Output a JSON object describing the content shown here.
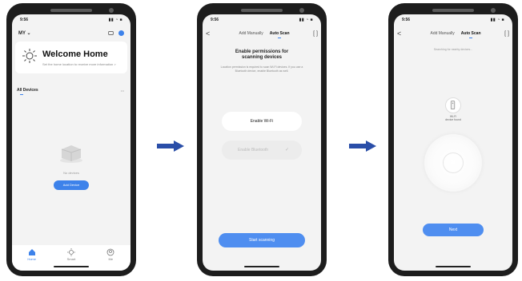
{
  "status_time": "9:56",
  "status_icons": "▮▮ ◔ ■",
  "phone1": {
    "user_label": "MY ⌄",
    "welcome_title": "Welcome Home",
    "welcome_subtitle": "Set the home location to receive more information >",
    "all_devices": "All Devices",
    "more": "•••",
    "no_devices": "No devices",
    "add_device_button": "Add Device",
    "tabs": [
      {
        "label": "Home"
      },
      {
        "label": "Smart"
      },
      {
        "label": "Me"
      }
    ]
  },
  "phone2": {
    "back": "<",
    "tab_manual": "Add Manually",
    "tab_auto": "Auto Scan",
    "scan_icon": "[ ]",
    "title_line1": "Enable permissions for",
    "title_line2": "scanning devices",
    "description": "Location permission is required to scan Wi-Fi devices. If you use a Bluetooth device, enable Bluetooth as well.",
    "permission_wifi": "Enable Wi-Fi",
    "permission_bluetooth": "Enable Bluetooth",
    "check": "✓",
    "start_button": "Start scanning"
  },
  "phone3": {
    "back": "<",
    "tab_manual": "Add Manually",
    "tab_auto": "Auto Scan",
    "scan_icon": "[ ]",
    "subtitle": "Searching for nearby devices...",
    "device_label_1": "Wi-Fi",
    "device_label_2": "device found",
    "next_button": "Next"
  },
  "colors": {
    "accent": "#3d82ea",
    "phone_body": "#1d1d1d",
    "arrow": "#2a4ea8"
  }
}
